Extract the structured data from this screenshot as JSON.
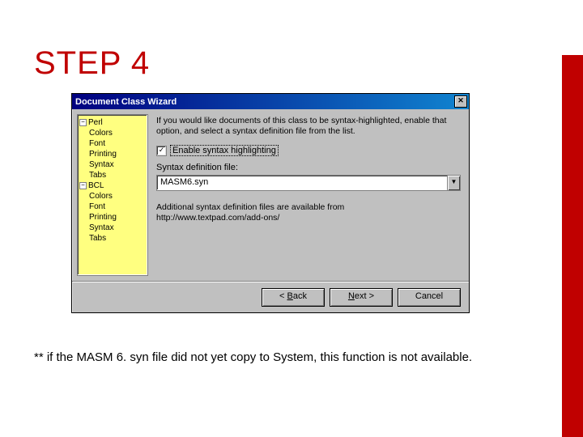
{
  "heading": "STEP 4",
  "window": {
    "title": "Document Class Wizard",
    "instructions": "If you would like documents of this class to be syntax-highlighted, enable that option, and select a syntax definition file from the list.",
    "checkbox_label": "Enable syntax highlighting",
    "field_label": "Syntax definition file:",
    "field_value": "MASM6.syn",
    "note_line1": "Additional syntax definition files are available from",
    "note_line2": "http://www.textpad.com/add-ons/",
    "buttons": {
      "back": "< Back",
      "next": "Next >",
      "cancel": "Cancel"
    }
  },
  "tree": {
    "group1": "Perl",
    "group2": "BCL",
    "children": [
      "Colors",
      "Font",
      "Printing",
      "Syntax",
      "Tabs"
    ]
  },
  "footnote": "** if the MASM 6. syn file did not yet copy to System, this function is not available."
}
